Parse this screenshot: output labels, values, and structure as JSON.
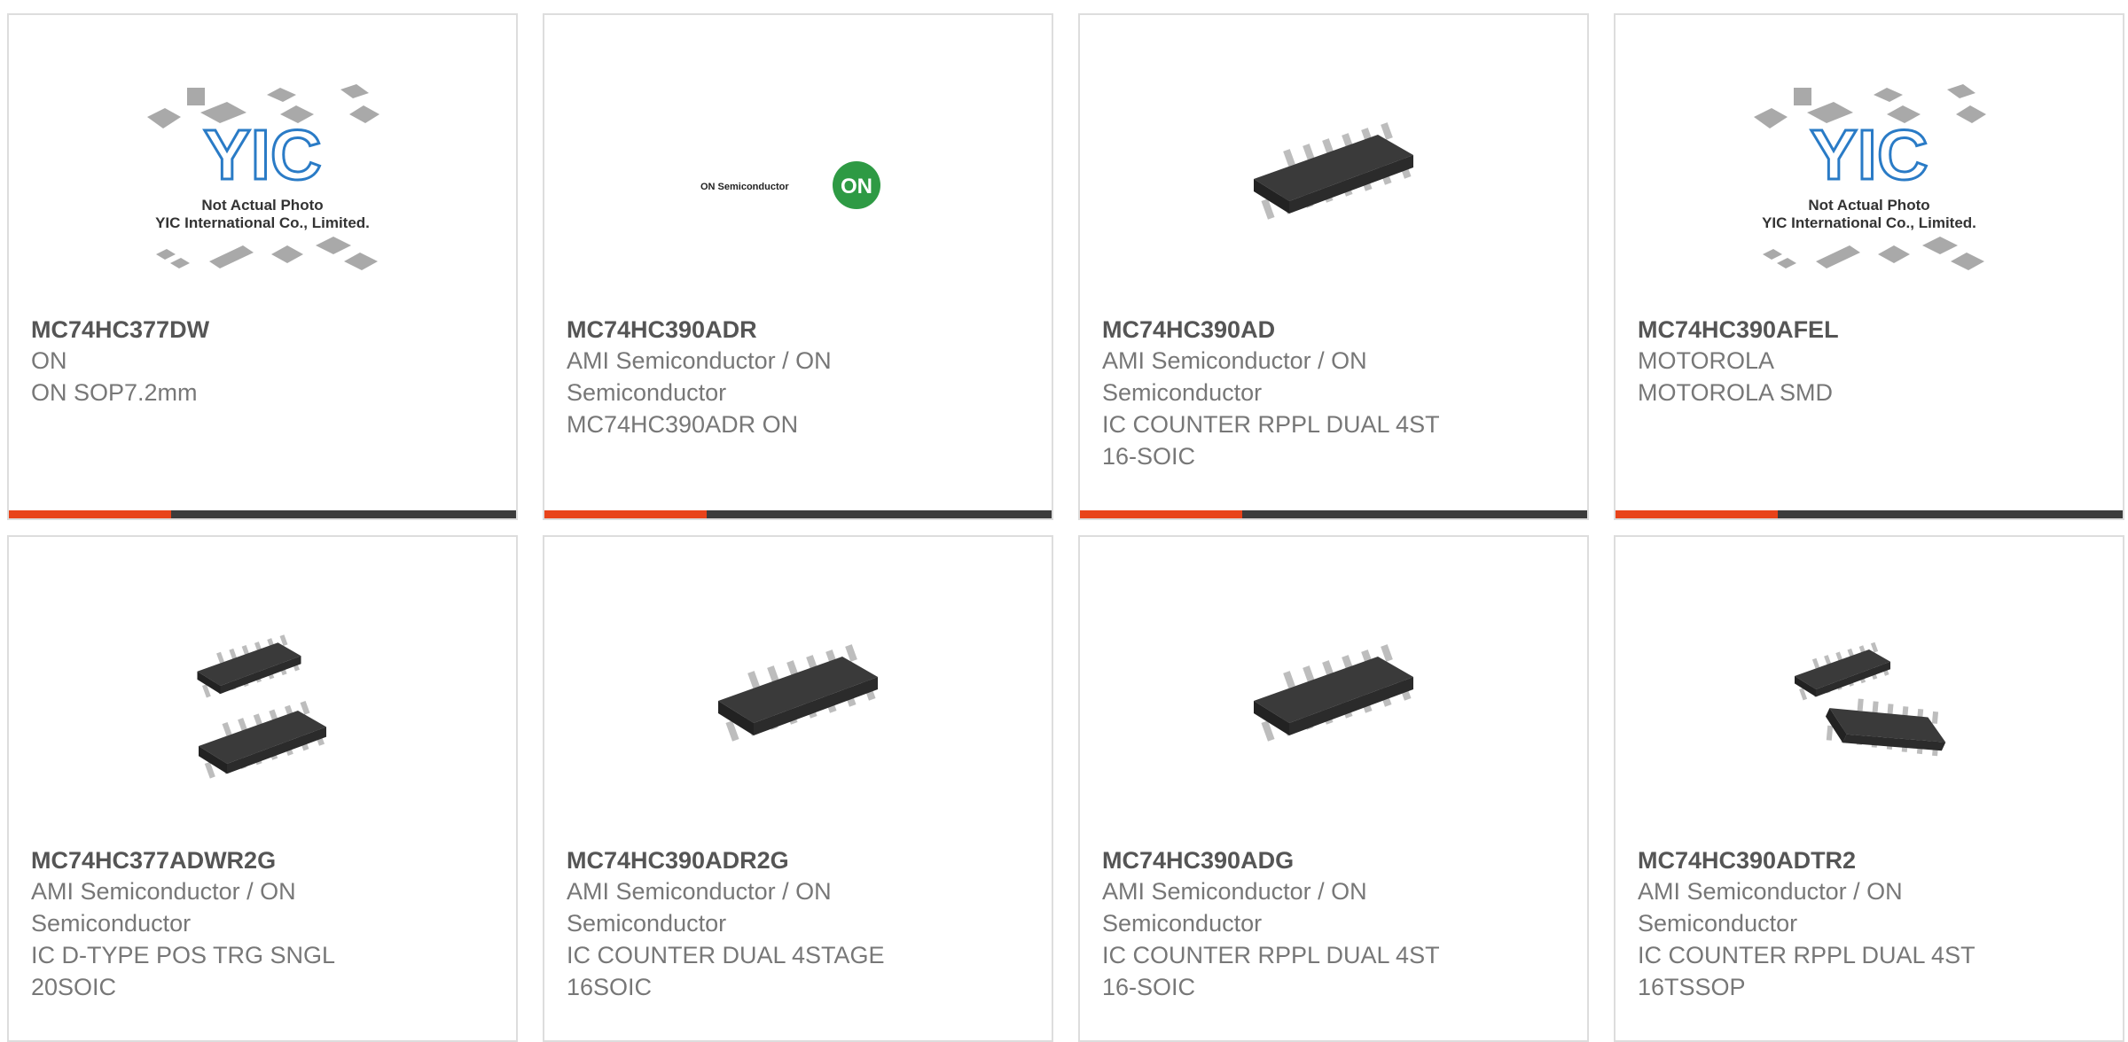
{
  "products": [
    {
      "part": "MC74HC377DW",
      "maker": "ON",
      "desc": "ON SOP7.2mm",
      "image": "yic-placeholder",
      "placeholder_text_1": "Not Actual Photo",
      "placeholder_text_2": "YIC International Co., Limited.",
      "placeholder_logo": "YIC"
    },
    {
      "part": "MC74HC390ADR",
      "maker_l1": "AMI Semiconductor / ON",
      "maker_l2": "Semiconductor",
      "desc": "MC74HC390ADR ON",
      "image": "on-semiconductor-logo",
      "logo_text": "ON Semiconductor",
      "logo_badge": "ON"
    },
    {
      "part": "MC74HC390AD",
      "maker_l1": "AMI Semiconductor / ON",
      "maker_l2": "Semiconductor",
      "desc_l1": "IC COUNTER RPPL DUAL 4ST",
      "desc_l2": "16-SOIC",
      "image": "soic-chip"
    },
    {
      "part": "MC74HC390AFEL",
      "maker": "MOTOROLA",
      "desc": "MOTOROLA SMD",
      "image": "yic-placeholder",
      "placeholder_text_1": "Not Actual Photo",
      "placeholder_text_2": "YIC International Co., Limited.",
      "placeholder_logo": "YIC"
    },
    {
      "part": "MC74HC377ADWR2G",
      "maker_l1": "AMI Semiconductor / ON",
      "maker_l2": "Semiconductor",
      "desc_l1": "IC D-TYPE POS TRG SNGL",
      "desc_l2": "20SOIC",
      "image": "soic-chip-pair"
    },
    {
      "part": "MC74HC390ADR2G",
      "maker_l1": "AMI Semiconductor / ON",
      "maker_l2": "Semiconductor",
      "desc_l1": "IC COUNTER DUAL 4STAGE",
      "desc_l2": "16SOIC",
      "image": "soic-chip"
    },
    {
      "part": "MC74HC390ADG",
      "maker_l1": "AMI Semiconductor / ON",
      "maker_l2": "Semiconductor",
      "desc_l1": "IC COUNTER RPPL DUAL 4ST",
      "desc_l2": "16-SOIC",
      "image": "soic-chip"
    },
    {
      "part": "MC74HC390ADTR2",
      "maker_l1": "AMI Semiconductor / ON",
      "maker_l2": "Semiconductor",
      "desc_l1": "IC COUNTER RPPL DUAL 4ST",
      "desc_l2": "16TSSOP",
      "image": "tssop-chip-pair"
    }
  ],
  "colors": {
    "accent": "#e8431a",
    "bar_dark": "#3c3c3c",
    "border": "#dddddd",
    "part_text": "#555555",
    "body_text": "#777777",
    "logo_blue": "#2a7bc6",
    "logo_green": "#2e9a44"
  }
}
